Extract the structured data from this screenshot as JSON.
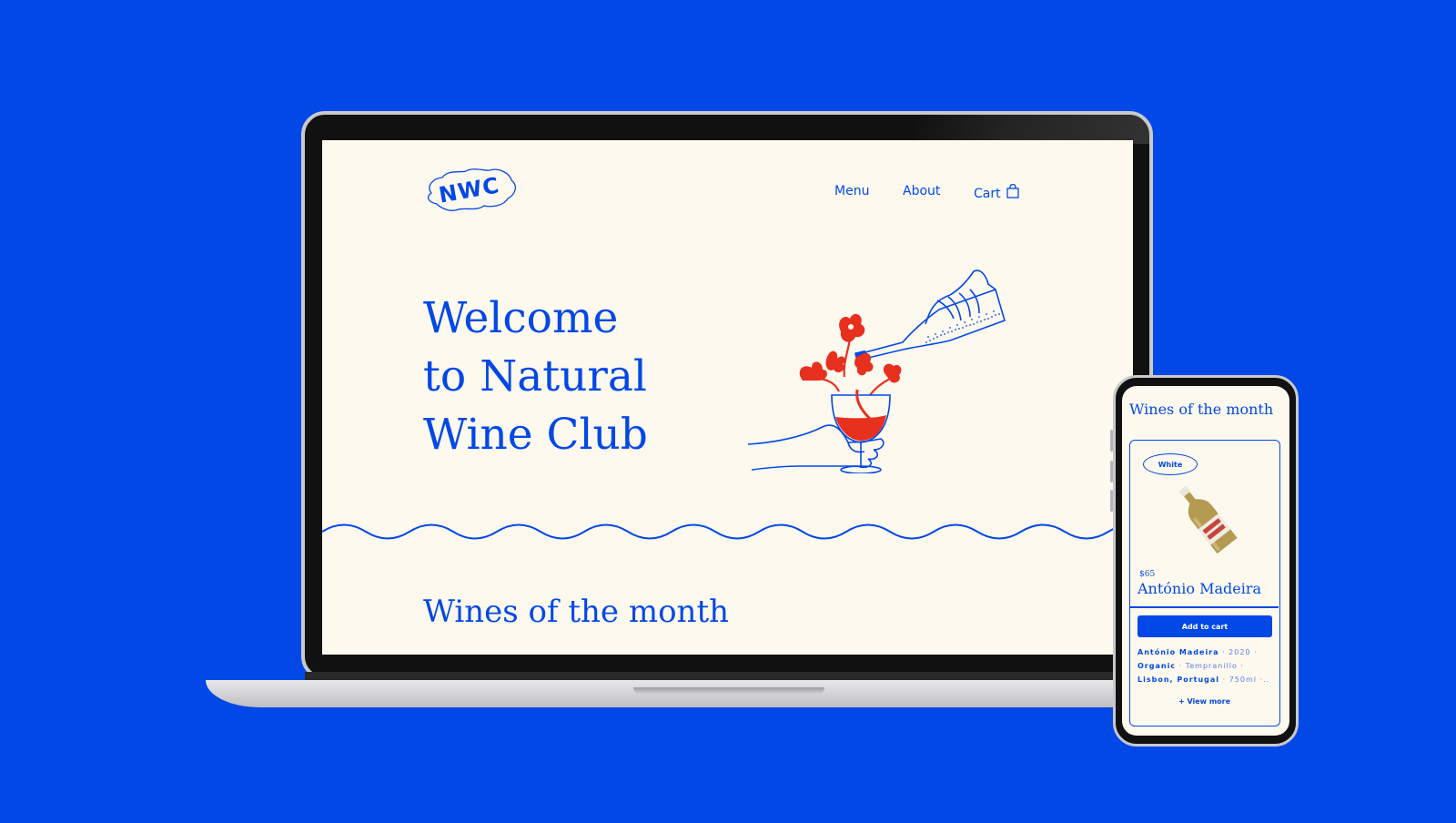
{
  "brand": {
    "logo_text": "NWC",
    "accent": "#0248e6",
    "illustration_red": "#e8301f",
    "cream": "#fdf9ee",
    "background": "#0248e6"
  },
  "nav": {
    "menu": "Menu",
    "about": "About",
    "cart": "Cart",
    "cart_icon": "shopping-bag-icon"
  },
  "hero": {
    "line1": "Welcome",
    "line2": "to Natural",
    "line3": "Wine Club",
    "illustration": "hand-pouring-wine-illustration"
  },
  "section": {
    "title": "Wines of the month"
  },
  "mobile": {
    "title": "Wines of the month",
    "card": {
      "tag": "White",
      "price": "$65",
      "name": "António Madeira",
      "add_to_cart": "Add to cart",
      "meta": {
        "producer": "António Madeira",
        "year": "2020",
        "organic": "Organic",
        "grape": "Tempranillo",
        "origin": "Lisbon, Portugal",
        "volume": "750ml"
      },
      "view_more": "+ View more"
    }
  }
}
